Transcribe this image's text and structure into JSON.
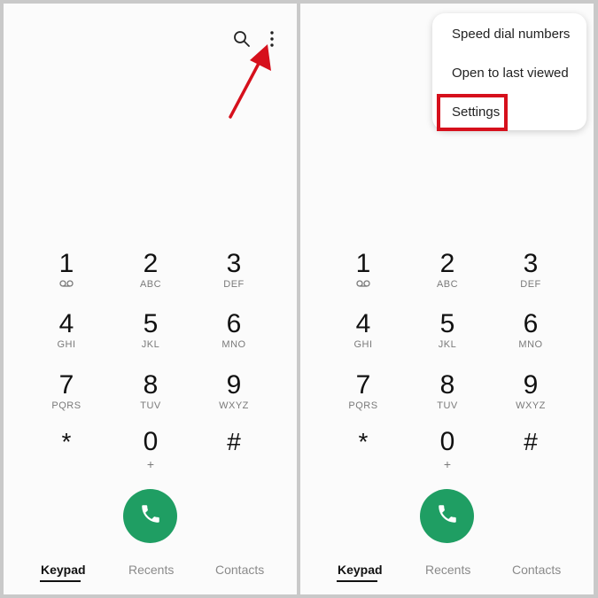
{
  "colors": {
    "accent_call": "#1f9e63",
    "highlight": "#d6101c",
    "arrow": "#d6101c"
  },
  "icons": {
    "search": "search-icon",
    "more": "more-vertical-icon",
    "phone": "phone-icon",
    "voicemail": "voicemail-icon"
  },
  "keys": [
    {
      "digit": "1",
      "letters": ""
    },
    {
      "digit": "2",
      "letters": "ABC"
    },
    {
      "digit": "3",
      "letters": "DEF"
    },
    {
      "digit": "4",
      "letters": "GHI"
    },
    {
      "digit": "5",
      "letters": "JKL"
    },
    {
      "digit": "6",
      "letters": "MNO"
    },
    {
      "digit": "7",
      "letters": "PQRS"
    },
    {
      "digit": "8",
      "letters": "TUV"
    },
    {
      "digit": "9",
      "letters": "WXYZ"
    },
    {
      "digit": "*",
      "letters": ""
    },
    {
      "digit": "0",
      "letters": "+"
    },
    {
      "digit": "#",
      "letters": ""
    }
  ],
  "nav": {
    "keypad": "Keypad",
    "recents": "Recents",
    "contacts": "Contacts"
  },
  "menu": {
    "items": [
      "Speed dial numbers",
      "Open to last viewed",
      "Settings"
    ]
  }
}
